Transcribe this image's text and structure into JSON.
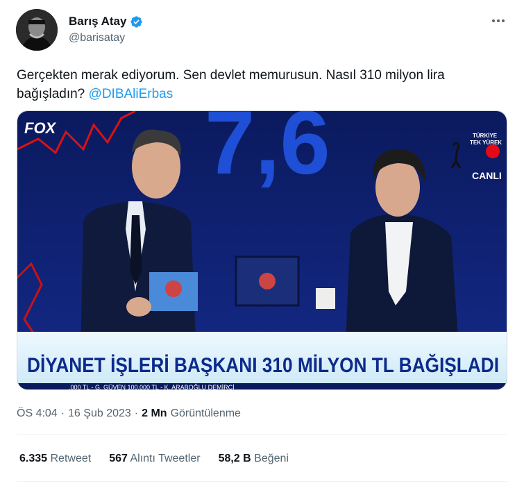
{
  "author": {
    "display_name": "Barış Atay",
    "handle": "@barisatay",
    "verified": true
  },
  "tweet": {
    "text_before": "Gerçekten merak ediyorum. Sen devlet memurusun. Nasıl 310 milyon lira bağışladın? ",
    "mention": "@DIBAliErbas"
  },
  "media": {
    "channel_logo": "FOX",
    "big_number": "7,6",
    "badge_line1": "TÜRKİYE",
    "badge_line2": "TEK YÜREK",
    "badge_live": "CANLI",
    "ticker_headline": "DİYANET İŞLERİ BAŞKANI 310 MİLYON TL BAĞIŞLADI",
    "crawl_text": ".000 TL  -  G. GÜVEN 100.000 TL  -  K. ARABOĞLU DEMİRCİ"
  },
  "meta": {
    "time": "ÖS 4:04",
    "sep1": "·",
    "date": "16 Şub 2023",
    "sep2": "·",
    "views_count": "2 Mn",
    "views_label": "Görüntülenme"
  },
  "stats": {
    "retweets_count": "6.335",
    "retweets_label": "Retweet",
    "quotes_count": "567",
    "quotes_label": "Alıntı Tweetler",
    "likes_count": "58,2 B",
    "likes_label": "Beğeni"
  },
  "colors": {
    "accent": "#1d9bf0",
    "secondary_text": "#536471",
    "primary_text": "#0f1419"
  }
}
